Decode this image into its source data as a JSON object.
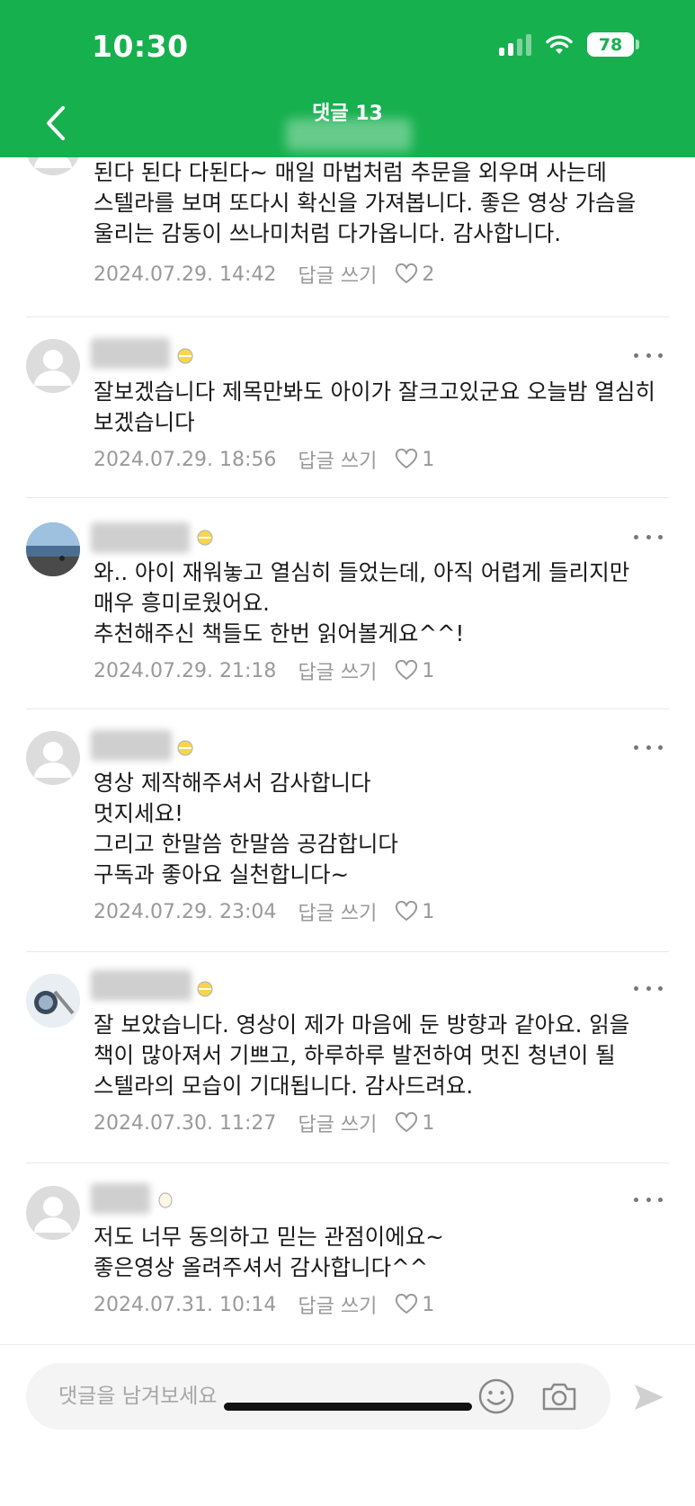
{
  "status": {
    "time": "10:30",
    "battery": "78"
  },
  "header": {
    "title": "댓글 13"
  },
  "comments": [
    {
      "text": "된다 된다 다된다~   매일 마법처럼 추문을 외우며 사는데 스텔라를 보며 또다시 확신을 가져봅니다. 좋은 영상 가슴을 울리는 감동이 쓰나미처럼 다가옵니다. 감사합니다.",
      "date": "2024.07.29. 14:42",
      "reply": "답글 쓰기",
      "likes": "2"
    },
    {
      "text": "잘보겠습니다 제목만봐도 아이가 잘크고있군요 오늘밤 열심히 보겠습니다",
      "date": "2024.07.29. 18:56",
      "reply": "답글 쓰기",
      "likes": "1"
    },
    {
      "text": "와.. 아이 재워놓고 열심히 들었는데, 아직 어렵게 들리지만 매우 흥미로웠어요.\n추천해주신 책들도 한번 읽어볼게요^^!",
      "date": "2024.07.29. 21:18",
      "reply": "답글 쓰기",
      "likes": "1"
    },
    {
      "text": "영상 제작해주셔서 감사합니다\n멋지세요!\n그리고 한말씀 한말씀 공감합니다\n구독과 좋아요 실천합니다~",
      "date": "2024.07.29. 23:04",
      "reply": "답글 쓰기",
      "likes": "1"
    },
    {
      "text": "잘 보았습니다. 영상이 제가 마음에 둔 방향과 같아요. 읽을 책이 많아져서 기쁘고, 하루하루 발전하여 멋진 청년이 될 스텔라의 모습이 기대됩니다. 감사드려요.",
      "date": "2024.07.30. 11:27",
      "reply": "답글 쓰기",
      "likes": "1"
    },
    {
      "text": "저도 너무 동의하고 믿는 관점이에요~\n좋은영상 올려주셔서 감사합니다^^",
      "date": "2024.07.31. 10:14",
      "reply": "답글 쓰기",
      "likes": "1"
    }
  ],
  "composer": {
    "placeholder": "댓글을 남겨보세요"
  },
  "colors": {
    "brand": "#16b04f",
    "meta": "#999999"
  }
}
